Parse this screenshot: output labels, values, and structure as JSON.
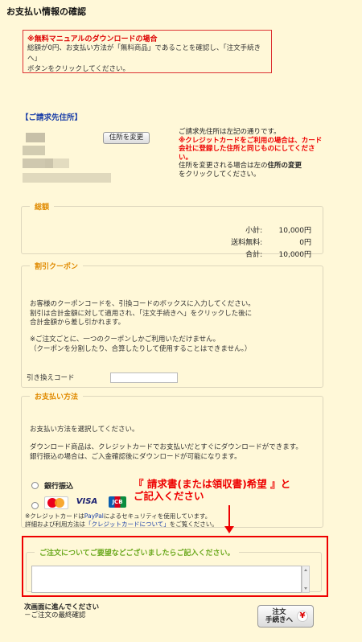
{
  "page": {
    "title": "お支払い情報の確認"
  },
  "notice": {
    "title": "※無料マニュアルのダウンロードの場合",
    "line1": "総額が0円、お支払い方法が「無料商品」であることを確認し、「注文手続きへ」",
    "line2": "ボタンをクリックしてください。"
  },
  "billing": {
    "heading": "【ご請求先住所】",
    "change_button": "住所を変更",
    "note_line1": "ご請求先住所は左記の通りです。",
    "note_red": "※クレジットカードをご利用の場合は、カード会社に登録した住所と同じものにしてください。",
    "note_line2": "住所を変更される場合は左の",
    "note_bold": "住所の変更",
    "note_line3": "をクリックしてください。"
  },
  "totals": {
    "legend": "総額",
    "rows": [
      {
        "label": "小計:",
        "value": "10,000円"
      },
      {
        "label": "送料無料:",
        "value": "0円"
      },
      {
        "label": "合計:",
        "value": "10,000円"
      }
    ]
  },
  "coupon": {
    "legend": "割引クーポン",
    "p1_line1": "お客様のクーポンコードを、引換コードのボックスに入力してください。",
    "p1_line2": "割引は合計金額に対して適用され、「注文手続きへ」をクリックした後に",
    "p1_line3": "合計金額から差し引かれます。",
    "p2_line1": "※ご注文ごとに、一つのクーポンしかご利用いただけません。",
    "p2_line2": "（クーポンを分割したり、合算したりして使用することはできません。）",
    "code_label": "引き換えコード",
    "code_value": ""
  },
  "payment": {
    "legend": "お支払い方法",
    "intro": "お支払い方法を選択してください。",
    "info_line1": "ダウンロード商品は、クレジットカードでお支払いだとすぐにダウンロードができます。",
    "info_line2": "銀行振込の場合は、ご入金確認後にダウンロードが可能になります。",
    "bank_transfer": "銀行振込",
    "cards": [
      "MasterCard",
      "VISA",
      "JCB"
    ],
    "cc_note_prefix": "※クレジットカードは",
    "cc_note_paypal": "PayPal",
    "cc_note_suffix": "によるセキュリティを使用しています。",
    "cc_detail_prefix": "詳細および利用方法は",
    "cc_detail_link": "「クレジットカードについて」",
    "cc_detail_suffix": "をご覧ください。"
  },
  "annotation": {
    "line1": "『 請求書(または領収書)希望 』と",
    "line2": "ご記入ください"
  },
  "comments": {
    "legend": "ご注文についてご要望などございましたらご記入ください。",
    "value": ""
  },
  "footer": {
    "next_title": "次画面に進んでください",
    "next_sub": "－ご注文の最終確認",
    "submit_line1": "注文",
    "submit_line2": "手続きへ"
  },
  "colors": {
    "background": "#fff8d8",
    "accent_red": "#e00000",
    "legend_orange": "#e08a00",
    "heading_blue": "#1a3ea8",
    "comment_green": "#6aa81c"
  }
}
